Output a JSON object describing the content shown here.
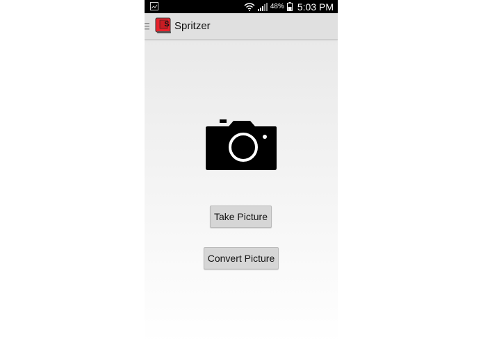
{
  "status_bar": {
    "battery_percent": "48%",
    "time": "5:03 PM",
    "icons": [
      "gallery-icon",
      "wifi-icon",
      "signal-icon",
      "battery-icon"
    ]
  },
  "action_bar": {
    "title": "Spritzer",
    "app_icon_letter": "S",
    "app_icon_color": "#e8222b"
  },
  "main": {
    "camera_icon": "camera-icon",
    "take_picture_label": "Take Picture",
    "convert_picture_label": "Convert Picture"
  }
}
